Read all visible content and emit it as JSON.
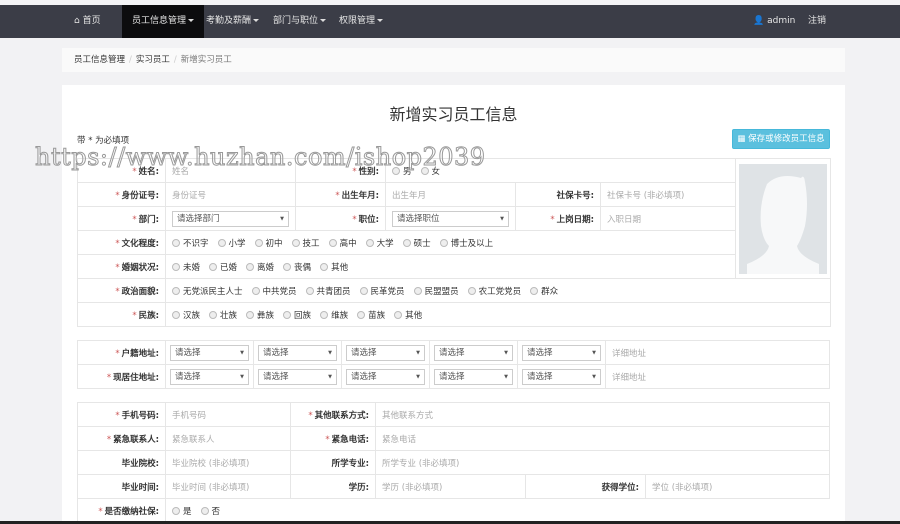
{
  "nav": {
    "home": "首页",
    "menus": [
      "员工信息管理",
      "考勤及薪酬",
      "部门与职位",
      "权限管理"
    ],
    "user": "admin",
    "logout": "注销"
  },
  "breadcrumb": [
    "员工信息管理",
    "实习员工",
    "新增实习员工"
  ],
  "title": "新增实习员工信息",
  "required_note": "带 * 为必填项",
  "save_button": "保存或修改员工信息",
  "watermark": "https://www.huzhan.com/ishop2039",
  "basic": {
    "name": {
      "label": "姓名:",
      "placeholder": "姓名"
    },
    "gender": {
      "label": "性别:",
      "options": [
        "男",
        "女"
      ]
    },
    "id_card": {
      "label": "身份证号:",
      "placeholder": "身份证号"
    },
    "birth": {
      "label": "出生年月:",
      "placeholder": "出生年月"
    },
    "social_card": {
      "label": "社保卡号:",
      "placeholder": "社保卡号 (非必填项)"
    },
    "dept": {
      "label": "部门:",
      "value": "请选择部门"
    },
    "position": {
      "label": "职位:",
      "value": "请选择职位"
    },
    "start_date": {
      "label": "上岗日期:",
      "placeholder": "入职日期"
    },
    "education": {
      "label": "文化程度:",
      "options": [
        "不识字",
        "小学",
        "初中",
        "技工",
        "高中",
        "大学",
        "硕士",
        "博士及以上"
      ]
    },
    "marital": {
      "label": "婚姻状况:",
      "options": [
        "未婚",
        "已婚",
        "离婚",
        "丧偶",
        "其他"
      ]
    },
    "political": {
      "label": "政治面貌:",
      "options": [
        "无党派民主人士",
        "中共党员",
        "共青团员",
        "民革党员",
        "民盟盟员",
        "农工党党员",
        "群众"
      ]
    },
    "ethnic": {
      "label": "民族:",
      "options": [
        "汉族",
        "壮族",
        "彝族",
        "回族",
        "维族",
        "苗族",
        "其他"
      ]
    }
  },
  "address": {
    "hukou": {
      "label": "户籍地址:",
      "selects": [
        "请选择",
        "请选择",
        "请选择",
        "请选择",
        "请选择"
      ],
      "placeholder": "详细地址"
    },
    "current": {
      "label": "现居住地址:",
      "selects": [
        "请选择",
        "请选择",
        "请选择",
        "请选择",
        "请选择"
      ],
      "placeholder": "详细地址"
    }
  },
  "contact": {
    "phone": {
      "label": "手机号码:",
      "placeholder": "手机号码"
    },
    "other": {
      "label": "其他联系方式:",
      "placeholder": "其他联系方式"
    },
    "emergency_contact": {
      "label": "紧急联系人:",
      "placeholder": "紧急联系人"
    },
    "emergency_phone": {
      "label": "紧急电话:",
      "placeholder": "紧急电话"
    },
    "school": {
      "label": "毕业院校:",
      "placeholder": "毕业院校 (非必填项)"
    },
    "major": {
      "label": "所学专业:",
      "placeholder": "所学专业 (非必填项)"
    },
    "grad_time": {
      "label": "毕业时间:",
      "placeholder": "毕业时间 (非必填项)"
    },
    "degree_edu": {
      "label": "学历:",
      "placeholder": "学历 (非必填项)"
    },
    "degree": {
      "label": "获得学位:",
      "placeholder": "学位 (非必填项)"
    },
    "social_insurance": {
      "label": "是否缴纳社保:",
      "options": [
        "是",
        "否"
      ]
    }
  }
}
